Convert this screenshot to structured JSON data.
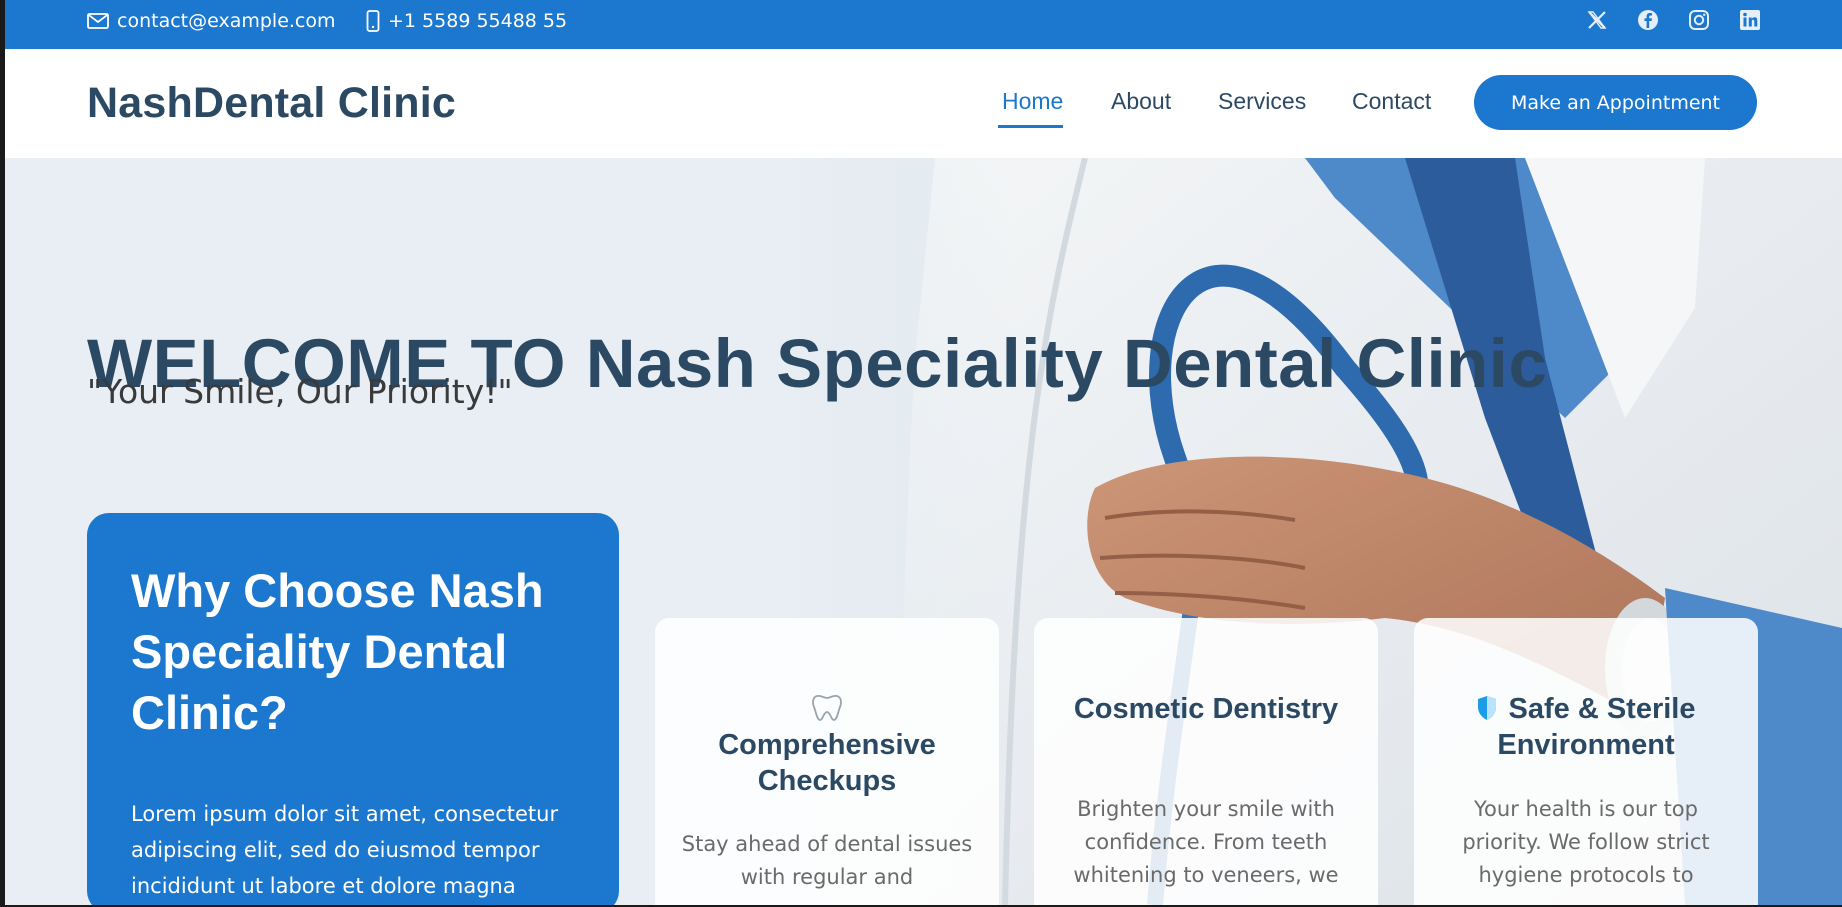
{
  "topbar": {
    "email": "contact@example.com",
    "phone": "+1 5589 55488 55",
    "social_icons": [
      "x-twitter-icon",
      "facebook-icon",
      "instagram-icon",
      "linkedin-icon"
    ]
  },
  "header": {
    "logo": "NashDental Clinic",
    "nav": [
      "Home",
      "About",
      "Services",
      "Contact"
    ],
    "active_nav": "Home",
    "cta": "Make an Appointment"
  },
  "hero": {
    "title": "WELCOME TO Nash Speciality Dental Clinic",
    "subtitle": "\"Your Smile, Our Priority!\""
  },
  "why": {
    "title": "Why Choose Nash Speciality Dental Clinic?",
    "text": "Lorem ipsum dolor sit amet, consectetur adipiscing elit, sed do eiusmod tempor incididunt ut labore et dolore magna"
  },
  "cards": [
    {
      "icon": "tooth-icon",
      "title": "Comprehensive Checkups",
      "text": "Stay ahead of dental issues with regular and"
    },
    {
      "icon": "",
      "title": "Cosmetic Dentistry",
      "text": "Brighten your smile with confidence. From teeth whitening to veneers, we"
    },
    {
      "icon": "shield-icon",
      "title": "Safe & Sterile Environment",
      "text": "Your health is our top priority. We follow strict hygiene protocols to"
    }
  ],
  "colors": {
    "accent": "#1c77cf",
    "heading": "#2c4964",
    "white": "#ffffff"
  }
}
